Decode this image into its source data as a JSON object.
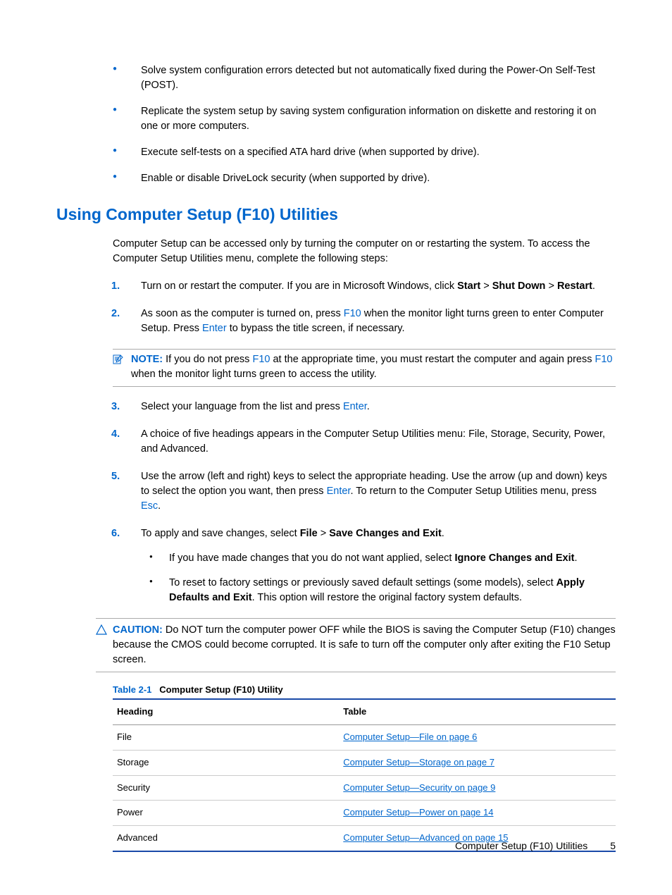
{
  "top_bullets": [
    "Solve system configuration errors detected but not automatically fixed during the Power-On Self-Test (POST).",
    "Replicate the system setup by saving system configuration information on diskette and restoring it on one or more computers.",
    "Execute self-tests on a specified ATA hard drive (when supported by drive).",
    "Enable or disable DriveLock security (when supported by drive)."
  ],
  "heading": "Using Computer Setup (F10) Utilities",
  "intro": "Computer Setup can be accessed only by turning the computer on or restarting the system. To access the Computer Setup Utilities menu, complete the following steps:",
  "steps": {
    "s1_a": "Turn on or restart the computer. If you are in Microsoft Windows, click ",
    "s1_b": "Start",
    "s1_c": " > ",
    "s1_d": "Shut Down",
    "s1_e": " > ",
    "s1_f": "Restart",
    "s1_g": ".",
    "s2_a": "As soon as the computer is turned on, press ",
    "s2_key1": "F10",
    "s2_b": " when the monitor light turns green to enter Computer Setup. Press ",
    "s2_key2": "Enter",
    "s2_c": " to bypass the title screen, if necessary.",
    "s3_a": "Select your language from the list and press ",
    "s3_key": "Enter",
    "s3_b": ".",
    "s4": "A choice of five headings appears in the Computer Setup Utilities menu: File, Storage, Security, Power, and Advanced.",
    "s5_a": "Use the arrow (left and right) keys to select the appropriate heading. Use the arrow (up and down) keys to select the option you want, then press ",
    "s5_key1": "Enter",
    "s5_b": ". To return to the Computer Setup Utilities menu, press ",
    "s5_key2": "Esc",
    "s5_c": ".",
    "s6_a": "To apply and save changes, select ",
    "s6_b": "File",
    "s6_c": " > ",
    "s6_d": "Save Changes and Exit",
    "s6_e": ".",
    "sub1_a": "If you have made changes that you do not want applied, select ",
    "sub1_b": "Ignore Changes and Exit",
    "sub1_c": ".",
    "sub2_a": "To reset to factory settings or previously saved default settings (some models), select ",
    "sub2_b": "Apply Defaults and Exit",
    "sub2_c": ". This option will restore the original factory system defaults."
  },
  "note": {
    "label": "NOTE:",
    "a": "If you do not press ",
    "key1": "F10",
    "b": " at the appropriate time, you must restart the computer and again press ",
    "key2": "F10",
    "c": " when the monitor light turns green to access the utility."
  },
  "caution": {
    "label": "CAUTION:",
    "text": "Do NOT turn the computer power OFF while the BIOS is saving the Computer Setup (F10) changes because the CMOS could become corrupted. It is safe to turn off the computer only after exiting the F10 Setup screen."
  },
  "table": {
    "number": "Table 2-1",
    "title": "Computer Setup (F10) Utility",
    "col1": "Heading",
    "col2": "Table",
    "rows": [
      {
        "h": "File",
        "link": "Computer Setup—File on page 6"
      },
      {
        "h": "Storage",
        "link": "Computer Setup—Storage on page 7"
      },
      {
        "h": "Security",
        "link": "Computer Setup—Security on page 9"
      },
      {
        "h": "Power",
        "link": "Computer Setup—Power on page 14"
      },
      {
        "h": "Advanced",
        "link": "Computer Setup—Advanced on page 15"
      }
    ]
  },
  "footer": {
    "text": "Computer Setup (F10) Utilities",
    "page": "5"
  }
}
